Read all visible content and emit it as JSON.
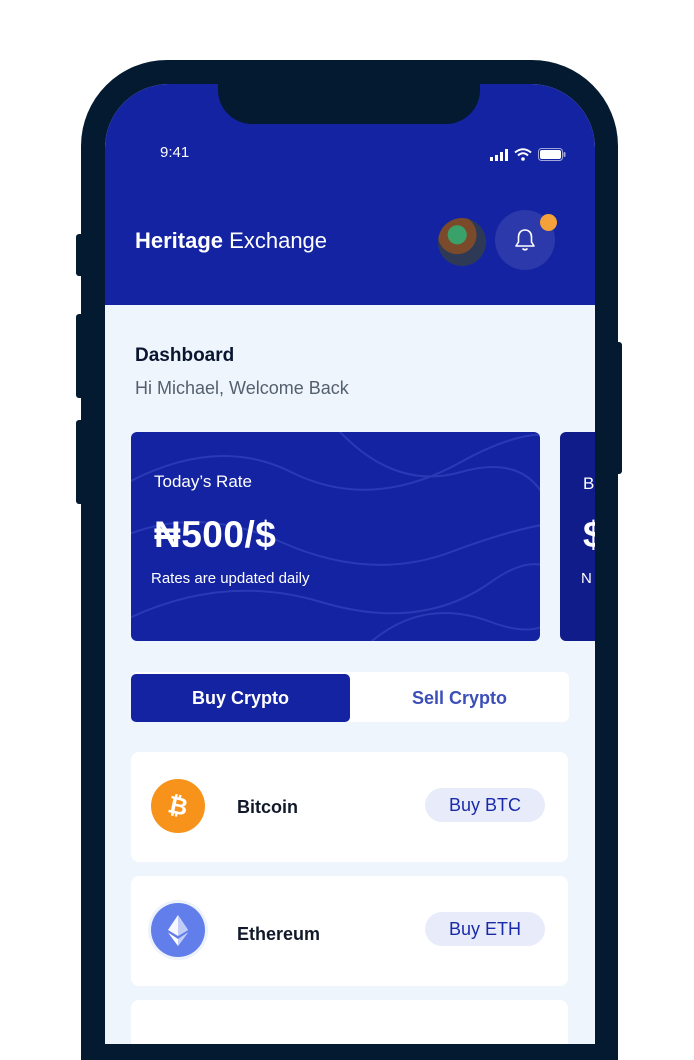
{
  "status_bar": {
    "time": "9:41"
  },
  "header": {
    "brand_bold": "Heritage",
    "brand_rest": "Exchange"
  },
  "dashboard": {
    "title": "Dashboard",
    "greeting": "Hi Michael, Welcome Back"
  },
  "rate_card": {
    "label": "Today’s Rate",
    "value": "₦500/$",
    "note": "Rates are updated daily"
  },
  "second_card": {
    "label": "B",
    "value": "$",
    "note": "N"
  },
  "tabs": {
    "buy": "Buy Crypto",
    "sell": "Sell Crypto"
  },
  "coins": [
    {
      "name": "Bitcoin",
      "action": "Buy BTC",
      "icon": "bitcoin-icon",
      "color": "#f7931a"
    },
    {
      "name": "Ethereum",
      "action": "Buy ETH",
      "icon": "ethereum-icon",
      "color": "#627eea"
    }
  ],
  "colors": {
    "primary": "#1423a1",
    "background": "#eef5fd",
    "notification": "#f5a13b"
  }
}
